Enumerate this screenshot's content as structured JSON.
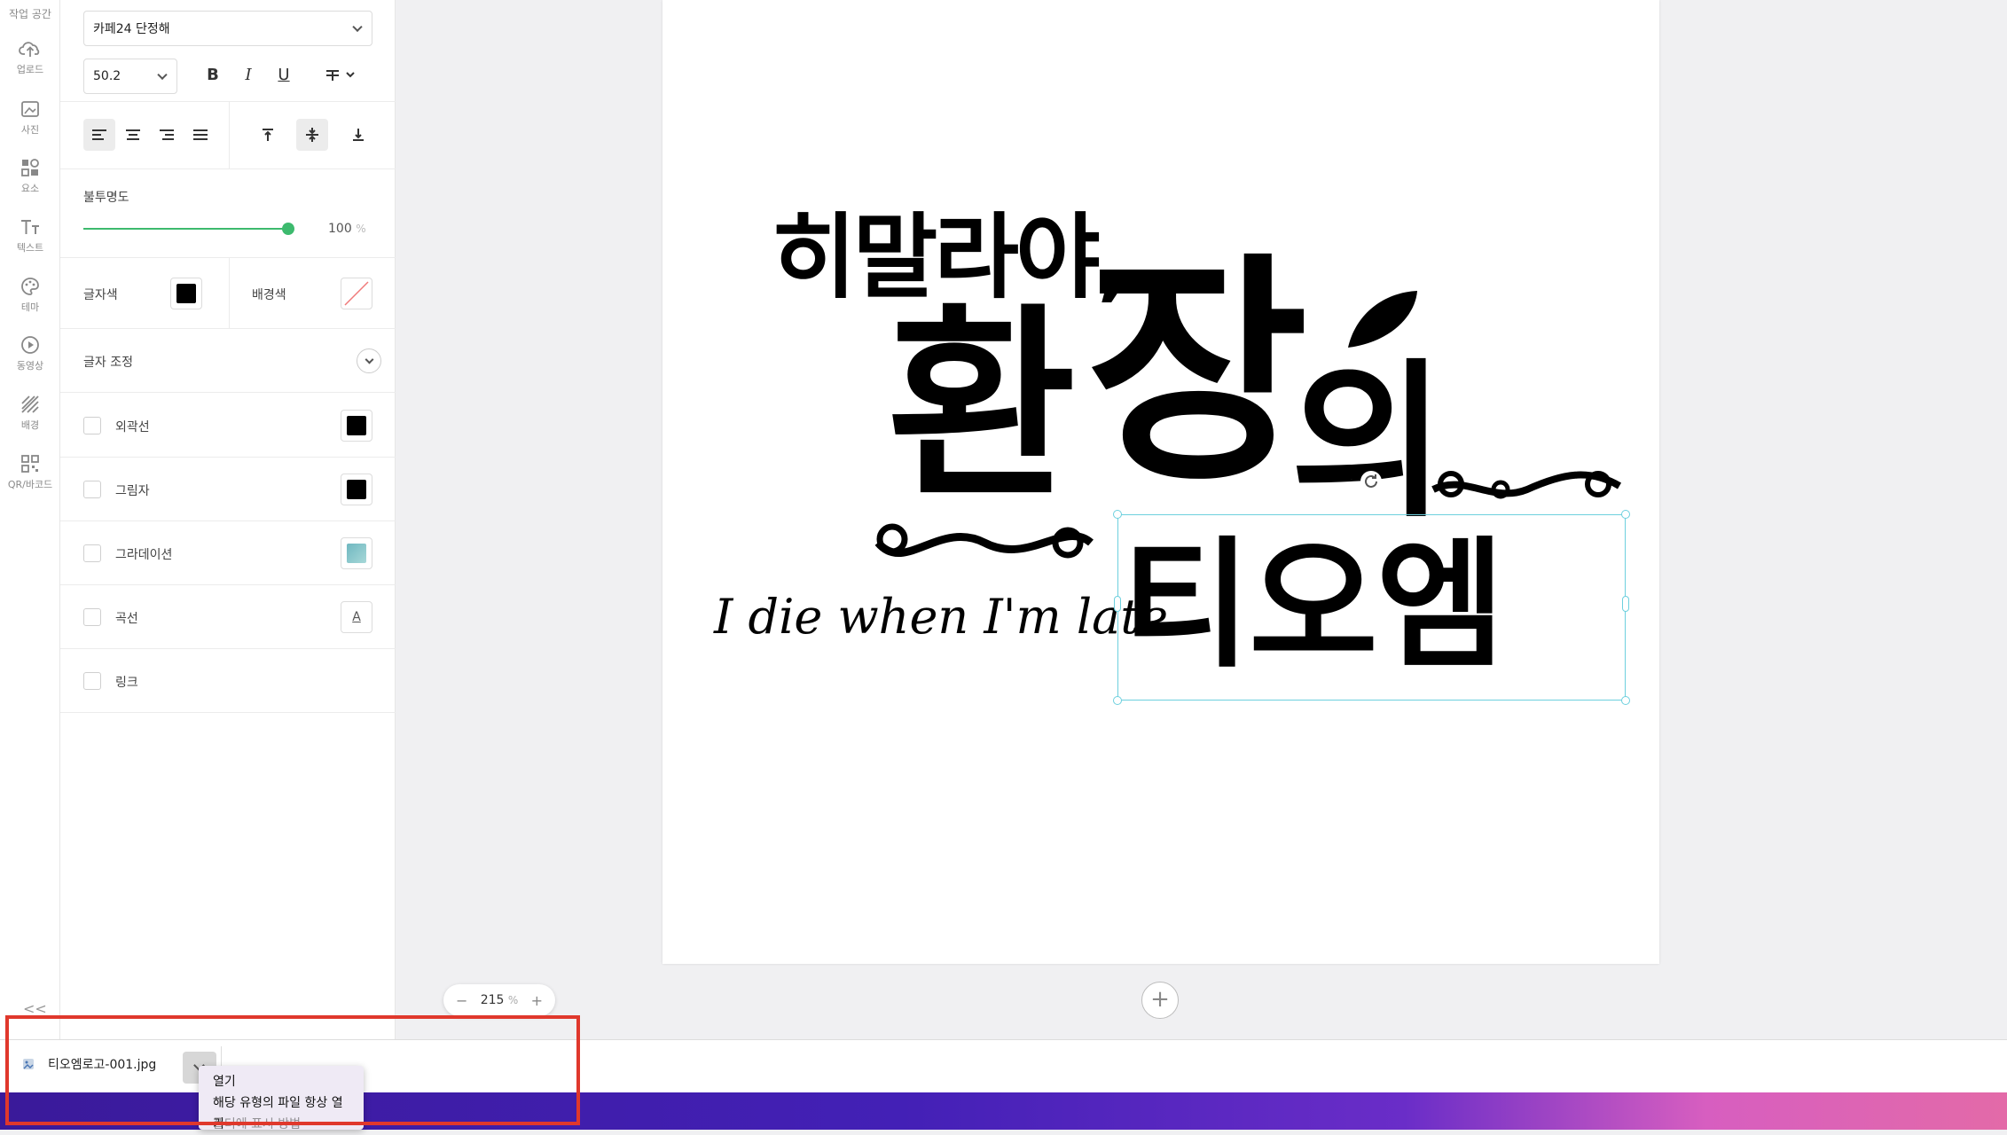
{
  "rail": {
    "top_label": "작업 공간",
    "items": [
      {
        "label": "업로드",
        "icon": "cloud-upload-icon"
      },
      {
        "label": "사진",
        "icon": "image-icon"
      },
      {
        "label": "요소",
        "icon": "shapes-icon"
      },
      {
        "label": "텍스트",
        "icon": "text-icon"
      },
      {
        "label": "테마",
        "icon": "palette-icon"
      },
      {
        "label": "동영상",
        "icon": "play-icon"
      },
      {
        "label": "배경",
        "icon": "hatch-icon"
      },
      {
        "label": "QR/바코드",
        "icon": "qr-icon"
      }
    ],
    "collapse": "<<"
  },
  "panel": {
    "font_name": "카페24 단정해",
    "font_size": "50.2",
    "bold": "B",
    "italic": "I",
    "underline": "U",
    "opacity_label": "불투명도",
    "opacity_value": "100",
    "opacity_unit": "%",
    "opacity_level": 1.0,
    "text_color_label": "글자색",
    "text_color": "#000000",
    "bg_color_label": "배경색",
    "letter_adjust_label": "글자 조정",
    "options": [
      {
        "label": "외곽선",
        "swatch": "#000000"
      },
      {
        "label": "그림자",
        "swatch": "#000000"
      },
      {
        "label": "그라데이션",
        "swatch": "#7fc4c8"
      },
      {
        "label": "곡선",
        "swatch_glyph": "A"
      },
      {
        "label": "링크"
      }
    ],
    "accent": "#3dba6e"
  },
  "canvas": {
    "line1": "히말라야,",
    "big1": "환",
    "big2": "장",
    "small_ui": "의",
    "tiom": "티오엠",
    "tagline": "I die when I'm late",
    "selection_color": "#6dd0de"
  },
  "zoom": {
    "minus": "−",
    "value": "215",
    "unit": "%",
    "plus": "+"
  },
  "add_page": "+",
  "download": {
    "filename": "티오엠로고-001.jpg",
    "menu": [
      "열기",
      "해당 유형의 파일 항상 열기",
      "폴더에 표시 방법"
    ]
  },
  "highlight_color": "#e0382c"
}
